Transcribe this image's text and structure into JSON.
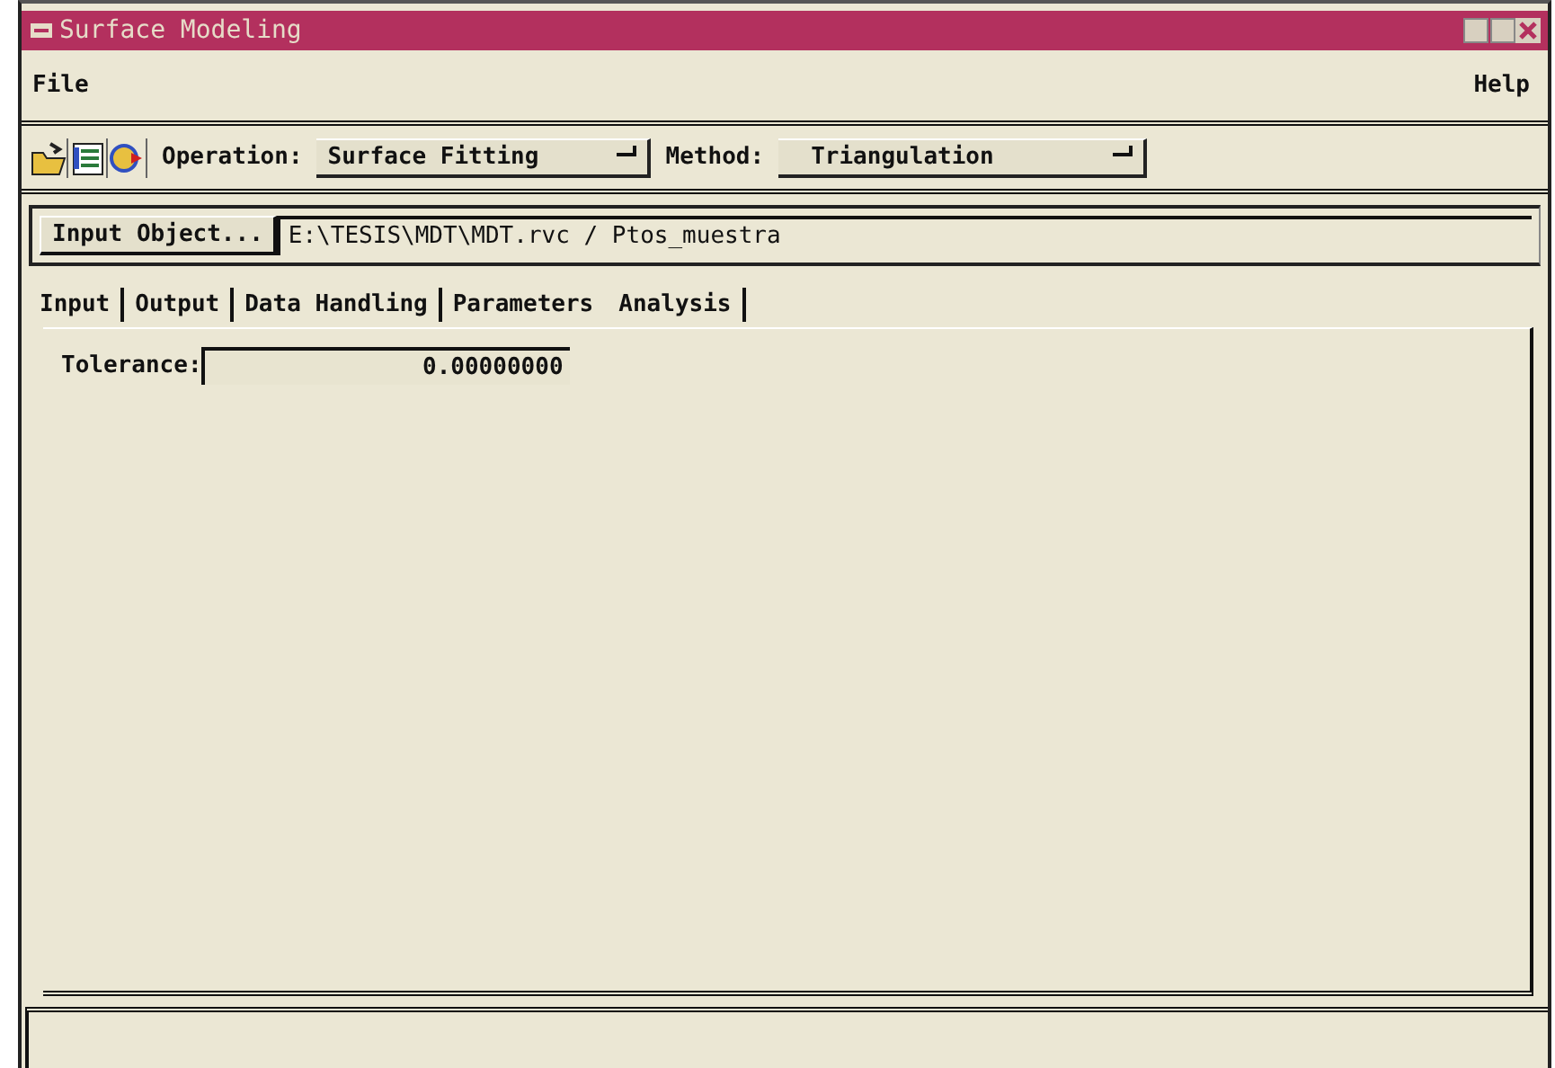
{
  "window": {
    "title": "Surface Modeling"
  },
  "menu": [
    "File",
    "Help"
  ],
  "toolbar": {
    "operation": {
      "label": "Operation:",
      "value": "Surface Fitting"
    },
    "method": {
      "label": "Method:",
      "value": "Triangulation"
    }
  },
  "input_object": {
    "button": "Input Object...",
    "value": "E:\\TESIS\\MDT\\MDT.rvc / Ptos_muestra"
  },
  "tabs": [
    {
      "label": "Input",
      "selected": false
    },
    {
      "label": "Output",
      "selected": false
    },
    {
      "label": "Data Handling",
      "selected": false
    },
    {
      "label": "Parameters",
      "selected": true
    },
    {
      "label": "Analysis",
      "selected": false
    }
  ],
  "parameters": {
    "tolerance": {
      "label": "Tolerance:",
      "value": "0.00000000"
    }
  }
}
